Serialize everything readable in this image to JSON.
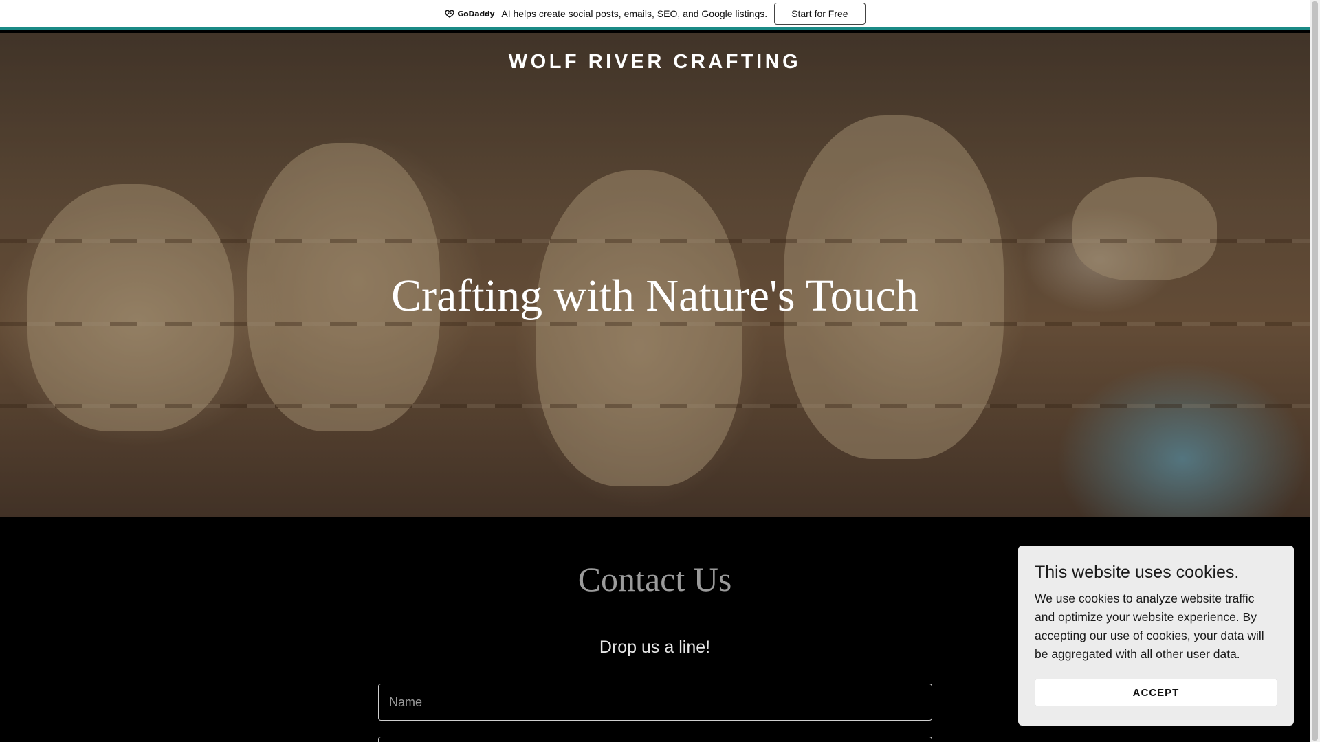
{
  "promo": {
    "logo_text": "GoDaddy",
    "message": "AI helps create social posts, emails, SEO, and Google listings.",
    "cta_label": "Start for Free",
    "accent_color": "#1b8a86"
  },
  "hero": {
    "site_title": "WOLF RIVER CRAFTING",
    "headline": "Crafting with Nature's Touch"
  },
  "contact": {
    "title": "Contact Us",
    "subtitle": "Drop us a line!",
    "name_placeholder": "Name",
    "email_placeholder": ""
  },
  "cookie_banner": {
    "title": "This website uses cookies.",
    "body": "We use cookies to analyze website traffic and optimize your website experience. By accepting our use of cookies, your data will be aggregated with all other user data.",
    "accept_label": "ACCEPT"
  }
}
